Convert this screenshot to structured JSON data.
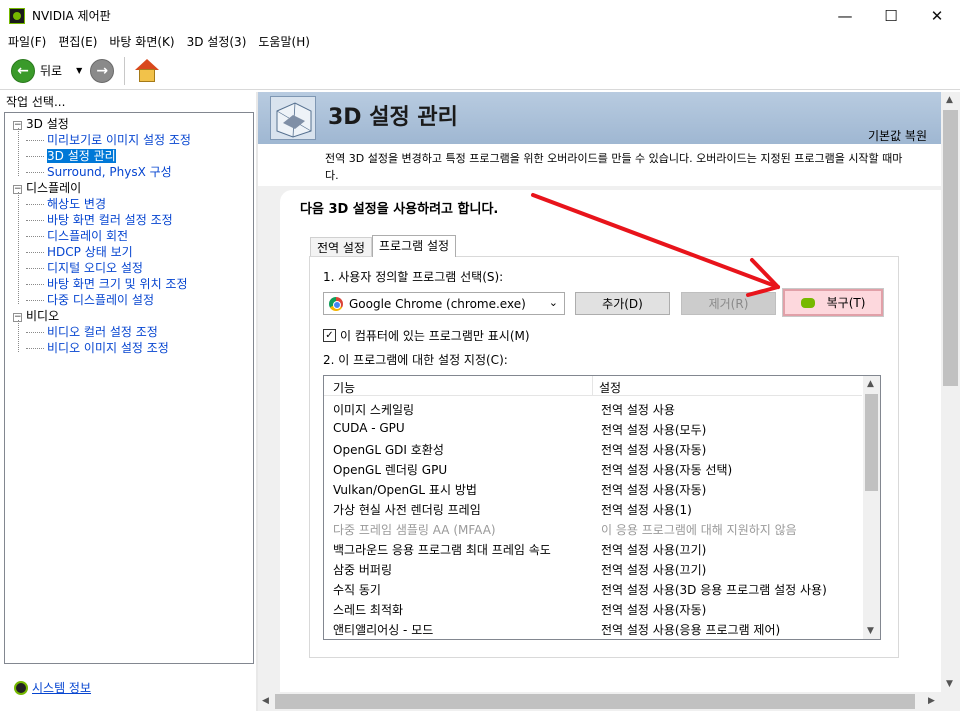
{
  "window": {
    "title": "NVIDIA 제어판",
    "controls": {
      "minimize": "—",
      "maximize": "☐",
      "close": "✕"
    }
  },
  "menu": [
    "파일(F)",
    "편집(E)",
    "바탕 화면(K)",
    "3D 설정(3)",
    "도움말(H)"
  ],
  "toolbar": {
    "back_label": "뒤로",
    "back_icon": "back-arrow-icon",
    "forward_icon": "forward-arrow-icon",
    "home_icon": "home-icon"
  },
  "sidebar": {
    "header": "작업 선택...",
    "groups": [
      {
        "label": "3D 설정",
        "items": [
          "미리보기로 이미지 설정 조정",
          "3D 설정 관리",
          "Surround, PhysX 구성"
        ],
        "selected": 1
      },
      {
        "label": "디스플레이",
        "items": [
          "해상도 변경",
          "바탕 화면 컬러 설정 조정",
          "디스플레이 회전",
          "HDCP 상태 보기",
          "디지털 오디오 설정",
          "바탕 화면 크기 및 위치 조정",
          "다중 디스플레이 설정"
        ]
      },
      {
        "label": "비디오",
        "items": [
          "비디오 컬러 설정 조정",
          "비디오 이미지 설정 조정"
        ]
      }
    ],
    "footer_link": "시스템 정보"
  },
  "page": {
    "title": "3D 설정 관리",
    "restore_defaults": "기본값 복원",
    "description": "전역 3D 설정을 변경하고 특정 프로그램을 위한 오버라이드를 만들 수 있습니다. 오버라이드는 지정된 프로그램을 시작할 때마",
    "description_cont": "다.",
    "section_title": "다음 3D 설정을 사용하려고 합니다.",
    "tabs": [
      "전역 설정",
      "프로그램 설정"
    ],
    "active_tab": 1,
    "step1_label": "1. 사용자 정의할 프로그램 선택(S):",
    "program_selected": "Google Chrome (chrome.exe)",
    "add_button": "추가(D)",
    "remove_button": "제거(R)",
    "restore_button": "복구(T)",
    "checkbox_label": "이 컴퓨터에 있는 프로그램만 표시(M)",
    "checkbox_checked": true,
    "step2_label": "2. 이 프로그램에 대한 설정 지정(C):",
    "table": {
      "headers": [
        "기능",
        "설정"
      ],
      "rows": [
        [
          "이미지 스케일링",
          "전역 설정 사용"
        ],
        [
          "CUDA - GPU",
          "전역 설정 사용(모두)"
        ],
        [
          "OpenGL GDI 호환성",
          "전역 설정 사용(자동)"
        ],
        [
          "OpenGL 렌더링 GPU",
          "전역 설정 사용(자동 선택)"
        ],
        [
          "Vulkan/OpenGL 표시 방법",
          "전역 설정 사용(자동)"
        ],
        [
          "가상 현실 사전 렌더링 프레임",
          "전역 설정 사용(1)"
        ],
        [
          "다중 프레임 샘플링 AA (MFAA)",
          "이 응용 프로그램에 대해 지원하지 않음"
        ],
        [
          "백그라운드 응용 프로그램 최대 프레임 속도",
          "전역 설정 사용(끄기)"
        ],
        [
          "삼중 버퍼링",
          "전역 설정 사용(끄기)"
        ],
        [
          "수직 동기",
          "전역 설정 사용(3D 응용 프로그램 설정 사용)"
        ],
        [
          "스레드 최적화",
          "전역 설정 사용(자동)"
        ],
        [
          "앤티앨리어싱 - 모드",
          "전역 설정 사용(응용 프로그램 제어)"
        ]
      ],
      "disabled_row": 6
    }
  },
  "colors": {
    "accent": "#0078d7",
    "nvidia_green": "#76b900",
    "annotation_red": "#e8141b",
    "restore_highlight": "#fdd8dd"
  }
}
